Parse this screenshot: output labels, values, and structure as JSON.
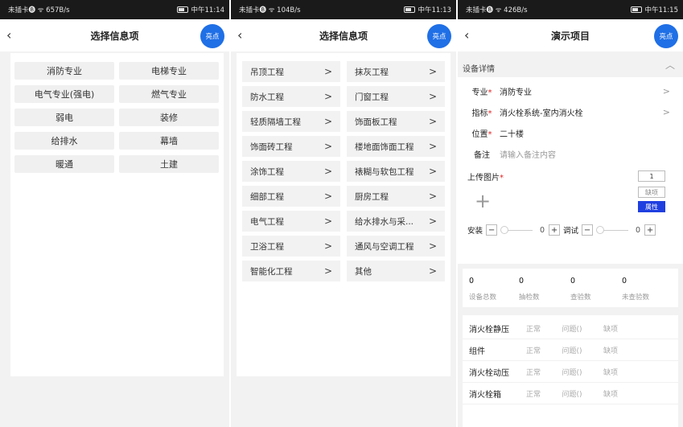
{
  "screens": [
    {
      "status": {
        "left": "未插卡🅑 ᯤ 657B/s",
        "right": "中午11:14"
      },
      "nav": {
        "title": "选择信息项",
        "light_label": "亮点"
      },
      "items": [
        "消防专业",
        "电梯专业",
        "电气专业(强电)",
        "燃气专业",
        "弱电",
        "装修",
        "给排水",
        "幕墙",
        "暖通",
        "土建"
      ]
    },
    {
      "status": {
        "left": "未插卡🅑 ᯤ 104B/s",
        "right": "中午11:13"
      },
      "nav": {
        "title": "选择信息项",
        "light_label": "亮点"
      },
      "items": [
        "吊顶工程",
        "抹灰工程",
        "防水工程",
        "门窗工程",
        "轻质隔墙工程",
        "饰面板工程",
        "饰面砖工程",
        "楼地面饰面工程",
        "涂饰工程",
        "裱糊与软包工程",
        "细部工程",
        "厨房工程",
        "电气工程",
        "给水排水与采...",
        "卫浴工程",
        "通风与空调工程",
        "智能化工程",
        "其他"
      ]
    },
    {
      "status": {
        "left": "未插卡🅑 ᯤ 426B/s",
        "right": "中午11:15"
      },
      "nav": {
        "title": "演示项目",
        "light_label": "亮点"
      },
      "section_title": "设备详情",
      "fields": [
        {
          "label": "专业",
          "required": "*",
          "value": "消防专业"
        },
        {
          "label": "指标",
          "required": "*",
          "value": "消火栓系统-室内消火栓"
        },
        {
          "label": "位置",
          "required": "*",
          "value": "二十楼"
        },
        {
          "label": "备注",
          "required": "",
          "value": "请输入备注内容"
        }
      ],
      "upload": {
        "label": "上传图片",
        "required": "*",
        "count": "1",
        "missing_label": "缺项",
        "attr_label": "属性"
      },
      "steppers": [
        {
          "label": "安装",
          "value": "0"
        },
        {
          "label": "调试",
          "value": "0"
        }
      ],
      "stats": [
        {
          "value": "0",
          "label": "设备总数"
        },
        {
          "value": "0",
          "label": "抽检数"
        },
        {
          "value": "0",
          "label": "查验数"
        },
        {
          "value": "0",
          "label": "未查验数"
        }
      ],
      "checks": {
        "options": [
          "正常",
          "问题()",
          "缺项"
        ],
        "rows": [
          "消火栓静压",
          "组件",
          "消火栓动压",
          "消火栓箱"
        ]
      }
    }
  ]
}
